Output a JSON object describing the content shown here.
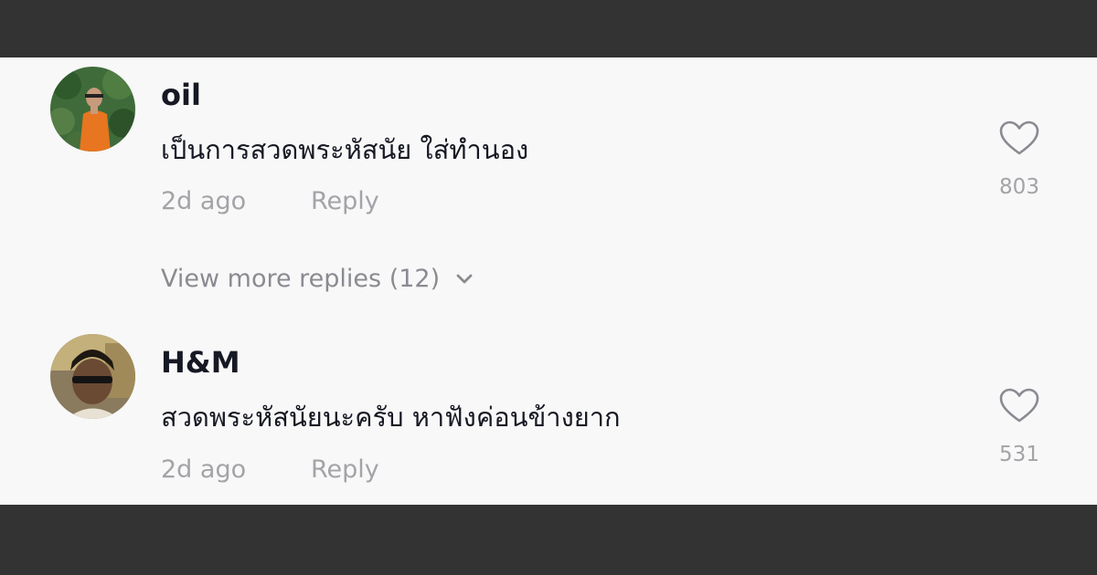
{
  "comments": [
    {
      "username": "oil",
      "text": "เป็นการสวดพระหัสนัย ใส่ทำนอง",
      "time": "2d ago",
      "reply_label": "Reply",
      "like_count": "803",
      "like_icon": "heart-outline-icon",
      "view_more_replies": "View more replies (12)"
    },
    {
      "username": "H&M",
      "text": "สวดพระหัสนัยนะครับ หาฟังค่อนข้างยาก",
      "time": "2d ago",
      "reply_label": "Reply",
      "like_count": "531",
      "like_icon": "heart-outline-icon"
    }
  ],
  "colors": {
    "frame": "#333333",
    "panel_background": "#f8f8f8",
    "primary_text": "#161823",
    "secondary_text": "#a3a3a8"
  }
}
